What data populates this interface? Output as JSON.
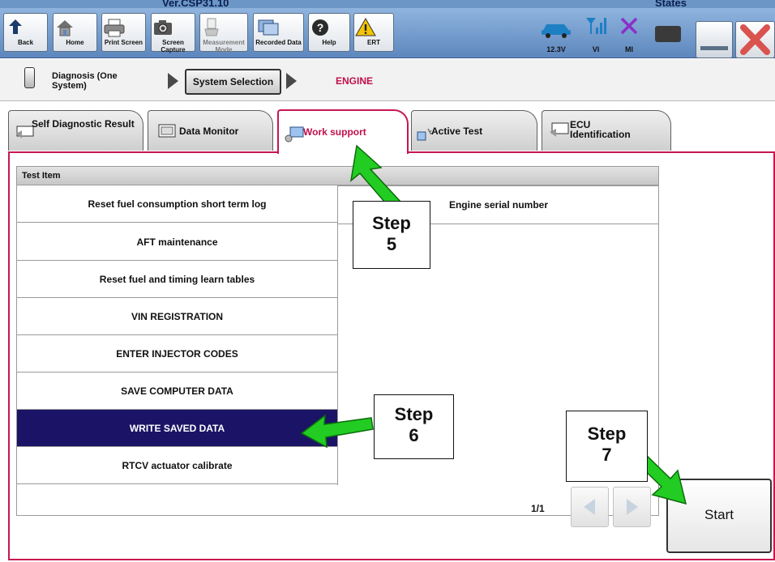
{
  "window": {
    "version": "Ver.CSP31.10",
    "states_text": "States"
  },
  "toolbar": {
    "buttons": [
      {
        "label": "Back",
        "icon": "back-arrow-icon"
      },
      {
        "label": "Home",
        "icon": "home-icon"
      },
      {
        "label": "Print Screen",
        "icon": "printer-icon"
      },
      {
        "label": "Screen Capture",
        "icon": "camera-icon"
      },
      {
        "label": "Measurement Mode",
        "icon": "measurement-icon"
      },
      {
        "label": "Recorded Data",
        "icon": "recorded-data-icon"
      },
      {
        "label": "Help",
        "icon": "help-icon"
      },
      {
        "label": "ERT",
        "icon": "warning-icon"
      }
    ],
    "status": [
      {
        "label": "12.3V",
        "icon": "car-icon"
      },
      {
        "label": "VI",
        "icon": "signal-icon"
      },
      {
        "label": "MI",
        "icon": "x-icon"
      }
    ]
  },
  "breadcrumb": {
    "diagnosis": "Diagnosis (One System)",
    "system_selection": "System Selection",
    "current": "ENGINE"
  },
  "tabs": [
    {
      "label": "Self Diagnostic Result",
      "active": false
    },
    {
      "label": "Data Monitor",
      "active": false
    },
    {
      "label": "Work support",
      "active": true
    },
    {
      "label": "Active Test",
      "active": false
    },
    {
      "label": "ECU Identification",
      "active": false
    }
  ],
  "table": {
    "header": "Test Item",
    "left_items": [
      "Reset fuel consumption short term log",
      "AFT maintenance",
      "Reset fuel and timing learn tables",
      "VIN REGISTRATION",
      "ENTER INJECTOR CODES",
      "SAVE COMPUTER DATA",
      "WRITE SAVED DATA",
      "RTCV actuator calibrate"
    ],
    "selected_item": "WRITE SAVED DATA",
    "right_items": [
      "Engine serial number"
    ]
  },
  "pager": {
    "text": "1/1"
  },
  "start_button": {
    "label": "Start"
  },
  "steps": [
    {
      "line1": "Step",
      "line2": "5"
    },
    {
      "line1": "Step",
      "line2": "6"
    },
    {
      "line1": "Step",
      "line2": "7"
    }
  ],
  "colors": {
    "accent_pink": "#c8174f",
    "selected_row": "#1b1466",
    "arrow_green": "#22cc22",
    "toolbar_blue": "#6b96c6"
  }
}
